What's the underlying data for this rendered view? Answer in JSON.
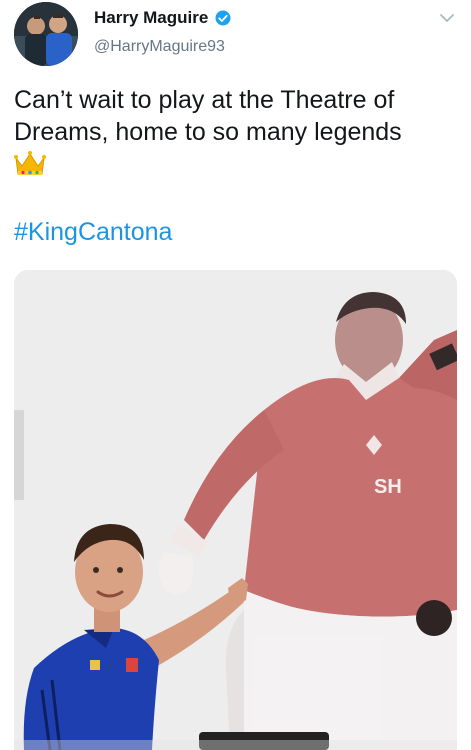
{
  "tweet": {
    "author_name": "Harry Maguire",
    "author_handle": "@HarryMaguire93",
    "text": "Can’t wait to play at the Theatre of Dreams, home to so many legends",
    "emoji": "👑",
    "hashtag": "#KingCantona"
  },
  "icons": {
    "verified": "verified-badge-icon",
    "menu": "chevron-down-icon",
    "crown": "crown-emoji-icon"
  },
  "colors": {
    "hashtag": "#1b95e0",
    "verified": "#1da1f2",
    "handle": "#657786",
    "mural_red": "#c66a6a"
  },
  "media": {
    "mural_shirt_text": "SH"
  }
}
